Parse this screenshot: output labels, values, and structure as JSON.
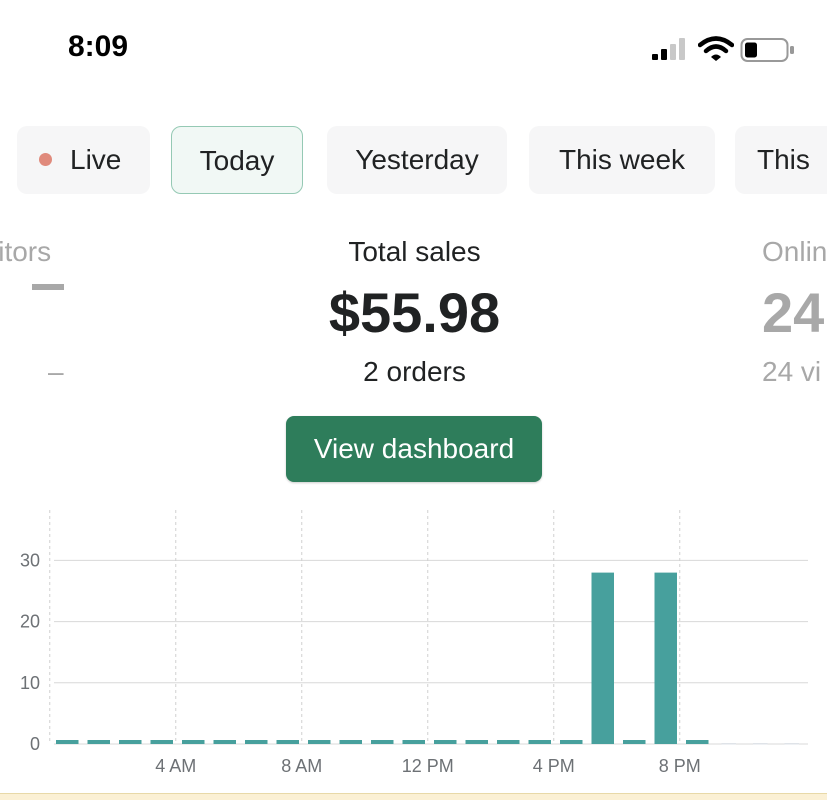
{
  "status_bar": {
    "time": "8:09"
  },
  "ranges": {
    "items": [
      {
        "label": "Live",
        "active": false
      },
      {
        "label": "Today",
        "active": true
      },
      {
        "label": "Yesterday",
        "active": false
      },
      {
        "label": "This week",
        "active": false
      },
      {
        "label": "This",
        "active": false
      }
    ]
  },
  "metrics": {
    "left": {
      "label": "isitors",
      "value": "–",
      "sub": "–"
    },
    "center": {
      "label": "Total sales",
      "value": "$55.98",
      "sub": "2 orders"
    },
    "right": {
      "label": "Onlin",
      "value": "24",
      "sub": "24 vi"
    }
  },
  "dashboard_button": {
    "label": "View dashboard"
  },
  "colors": {
    "accent": "#2e7d5b",
    "bar": "#47a09d",
    "live_dot": "#e08a7c"
  },
  "chart_data": {
    "type": "bar",
    "x_tick_labels": [
      "4 AM",
      "8 AM",
      "12 PM",
      "4 PM",
      "8 PM"
    ],
    "x_tick_hours": [
      4,
      8,
      12,
      16,
      20
    ],
    "ylim": [
      0,
      33
    ],
    "yticks": [
      0,
      10,
      20,
      30
    ],
    "hours": [
      0,
      1,
      2,
      3,
      4,
      5,
      6,
      7,
      8,
      9,
      10,
      11,
      12,
      13,
      14,
      15,
      16,
      17,
      18,
      19,
      20,
      21,
      22,
      23
    ],
    "values": [
      0.5,
      0.5,
      0.5,
      0.5,
      0.5,
      0.5,
      0.5,
      0.5,
      0.5,
      0.5,
      0.5,
      0.5,
      0.5,
      0.5,
      0.5,
      0.5,
      0.5,
      28,
      0.5,
      28,
      0.5,
      0,
      0,
      0
    ],
    "grid": true
  }
}
